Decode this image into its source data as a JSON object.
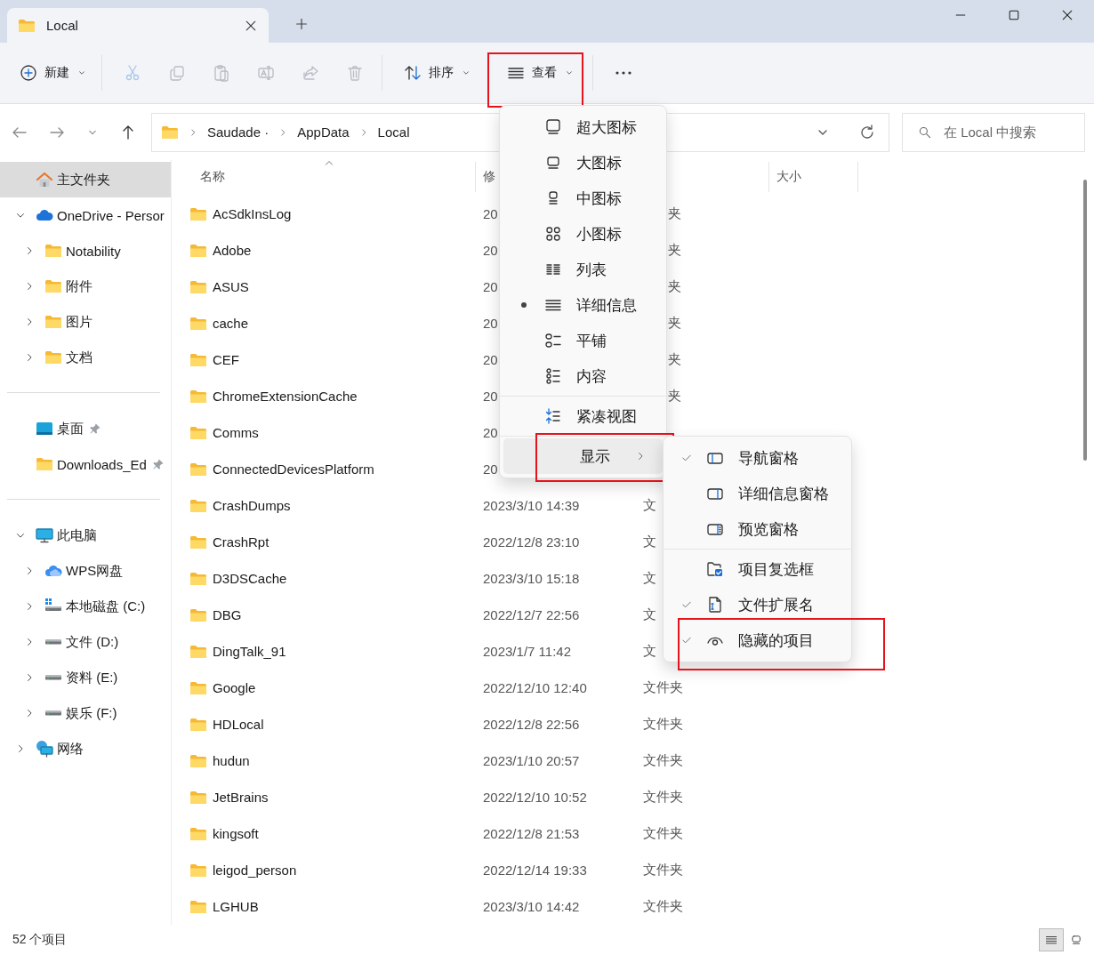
{
  "tab": {
    "title": "Local"
  },
  "toolbar": [
    {
      "kind": "new",
      "label": "新建",
      "disabled": false,
      "highlighted": false
    },
    {
      "kind": "cut",
      "disabled": true,
      "highlighted": false
    },
    {
      "kind": "copy",
      "disabled": true,
      "highlighted": false
    },
    {
      "kind": "paste",
      "disabled": true,
      "highlighted": false
    },
    {
      "kind": "rename",
      "disabled": true,
      "highlighted": false
    },
    {
      "kind": "share",
      "disabled": true,
      "highlighted": false
    },
    {
      "kind": "delete",
      "disabled": true,
      "highlighted": false
    },
    {
      "kind": "sort",
      "label": "排序",
      "disabled": false,
      "highlighted": false
    },
    {
      "kind": "view",
      "label": "查看",
      "disabled": false,
      "highlighted": true
    },
    {
      "kind": "more",
      "disabled": false,
      "highlighted": false
    }
  ],
  "address": {
    "path": [
      "Saudade ·",
      "AppData",
      "Local"
    ]
  },
  "search": {
    "placeholder": "在 Local 中搜索"
  },
  "sidebar": {
    "groups": [
      {
        "items": [
          {
            "kind": "home",
            "label": "主文件夹",
            "selected": true
          },
          {
            "kind": "cloud",
            "label": "OneDrive - Persor",
            "selected": false,
            "expanded": true,
            "children": [
              {
                "kind": "folder",
                "label": "Notability",
                "selected": false,
                "expanded": false
              },
              {
                "kind": "folder",
                "label": "附件",
                "selected": false,
                "expanded": false
              },
              {
                "kind": "folder",
                "label": "图片",
                "selected": false,
                "expanded": false
              },
              {
                "kind": "folder",
                "label": "文档",
                "selected": false,
                "expanded": false
              }
            ]
          }
        ]
      },
      {
        "items": [
          {
            "kind": "desktop",
            "label": "桌面",
            "selected": false,
            "pinned": true
          },
          {
            "kind": "folder",
            "label": "Downloads_Ed",
            "selected": false,
            "pinned": true
          }
        ]
      },
      {
        "items": [
          {
            "kind": "pc",
            "label": "此电脑",
            "selected": false,
            "expanded": true,
            "children": [
              {
                "kind": "wps",
                "label": "WPS网盘",
                "selected": false,
                "expanded": false
              },
              {
                "kind": "drive-win",
                "label": "本地磁盘 (C:)",
                "selected": false,
                "expanded": false
              },
              {
                "kind": "drive",
                "label": "文件 (D:)",
                "selected": false,
                "expanded": false
              },
              {
                "kind": "drive",
                "label": "资料 (E:)",
                "selected": false,
                "expanded": false
              },
              {
                "kind": "drive",
                "label": "娱乐 (F:)",
                "selected": false,
                "expanded": false
              }
            ]
          },
          {
            "kind": "network",
            "label": "网络",
            "selected": false,
            "expanded": false
          }
        ]
      }
    ]
  },
  "file_list": {
    "columns": [
      {
        "kind": "name",
        "label": "名称",
        "sorted": true
      },
      {
        "kind": "date",
        "label": "修",
        "sorted": false
      },
      {
        "kind": "type"
      },
      {
        "kind": "size",
        "label": "大小",
        "sorted": false
      }
    ],
    "rows": [
      {
        "name": "AcSdkInsLog",
        "modified": "20",
        "type": "夹",
        "type_tail": true
      },
      {
        "name": "Adobe",
        "modified": "20",
        "type": "夹",
        "type_tail": true
      },
      {
        "name": "ASUS",
        "modified": "20",
        "type": "夹",
        "type_tail": true
      },
      {
        "name": "cache",
        "modified": "20",
        "type": "夹",
        "type_tail": true
      },
      {
        "name": "CEF",
        "modified": "20",
        "type": "夹",
        "type_tail": true
      },
      {
        "name": "ChromeExtensionCache",
        "modified": "20",
        "type": "夹",
        "type_tail": true
      },
      {
        "name": "Comms",
        "modified": "20"
      },
      {
        "name": "ConnectedDevicesPlatform",
        "modified": "20"
      },
      {
        "name": "CrashDumps",
        "modified": "2023/3/10 14:39",
        "type": "文",
        "type_tail": false
      },
      {
        "name": "CrashRpt",
        "modified": "2022/12/8 23:10",
        "type": "文",
        "type_tail": false
      },
      {
        "name": "D3DSCache",
        "modified": "2023/3/10 15:18",
        "type": "文",
        "type_tail": false
      },
      {
        "name": "DBG",
        "modified": "2022/12/7 22:56",
        "type": "文",
        "type_tail": false
      },
      {
        "name": "DingTalk_91",
        "modified": "2023/1/7 11:42",
        "type": "文",
        "type_tail": false
      },
      {
        "name": "Google",
        "modified": "2022/12/10 12:40",
        "type": "文件夹",
        "type_tail": false
      },
      {
        "name": "HDLocal",
        "modified": "2022/12/8 22:56",
        "type": "文件夹",
        "type_tail": false
      },
      {
        "name": "hudun",
        "modified": "2023/1/10 20:57",
        "type": "文件夹",
        "type_tail": false
      },
      {
        "name": "JetBrains",
        "modified": "2022/12/10 10:52",
        "type": "文件夹",
        "type_tail": false
      },
      {
        "name": "kingsoft",
        "modified": "2022/12/8 21:53",
        "type": "文件夹",
        "type_tail": false
      },
      {
        "name": "leigod_person",
        "modified": "2022/12/14 19:33",
        "type": "文件夹",
        "type_tail": false
      },
      {
        "name": "LGHUB",
        "modified": "2023/3/10 14:42",
        "type": "文件夹",
        "type_tail": false
      }
    ]
  },
  "view_menu": {
    "groups": [
      {
        "items": [
          {
            "kind": "xl",
            "label": "超大图标",
            "selected": false,
            "highlighted": false
          },
          {
            "kind": "large",
            "label": "大图标",
            "selected": false,
            "highlighted": false
          },
          {
            "kind": "medium",
            "label": "中图标",
            "selected": false,
            "highlighted": false
          },
          {
            "kind": "small",
            "label": "小图标",
            "selected": false,
            "highlighted": false
          },
          {
            "kind": "list",
            "label": "列表",
            "selected": false,
            "highlighted": false
          },
          {
            "kind": "details",
            "label": "详细信息",
            "selected": true,
            "highlighted": false
          },
          {
            "kind": "tiles",
            "label": "平铺",
            "selected": false,
            "highlighted": false
          },
          {
            "kind": "content",
            "label": "内容",
            "selected": false,
            "highlighted": false
          }
        ]
      },
      {
        "items": [
          {
            "kind": "compact",
            "label": "紧凑视图",
            "highlighted": false
          }
        ]
      },
      {
        "items": [
          {
            "kind": "submenu",
            "label": "显示",
            "hovered": true,
            "highlighted": true
          }
        ]
      }
    ]
  },
  "show_menu": {
    "groups": [
      {
        "items": [
          {
            "kind": "nav-pane",
            "label": "导航窗格",
            "checked": true,
            "highlighted": false
          },
          {
            "kind": "details-pane",
            "label": "详细信息窗格",
            "checked": false,
            "highlighted": false
          },
          {
            "kind": "preview-pane",
            "label": "预览窗格",
            "checked": false,
            "highlighted": false
          }
        ]
      },
      {
        "items": [
          {
            "kind": "checkbox",
            "label": "项目复选框",
            "checked": false,
            "highlighted": false
          },
          {
            "kind": "extension",
            "label": "文件扩展名",
            "checked": true,
            "highlighted": false
          },
          {
            "kind": "hidden",
            "label": "隐藏的项目",
            "checked": true,
            "highlighted": true
          }
        ]
      }
    ]
  },
  "status_bar": {
    "text": "52 个项目",
    "view_buttons": [
      {
        "kind": "details",
        "selected": true
      },
      {
        "kind": "large",
        "selected": false
      }
    ]
  }
}
